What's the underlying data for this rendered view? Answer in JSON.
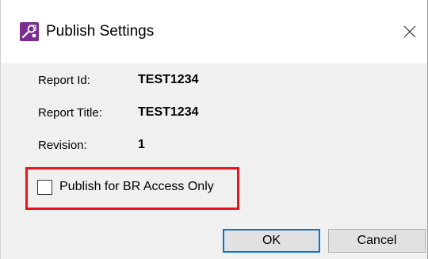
{
  "dialog": {
    "title": "Publish Settings",
    "close_icon": "close-icon",
    "app_icon": "publish-settings-app-icon"
  },
  "fields": [
    {
      "label": "Report Id:",
      "value": "TEST1234"
    },
    {
      "label": "Report Title:",
      "value": "TEST1234"
    },
    {
      "label": "Revision:",
      "value": "1"
    }
  ],
  "br_access": {
    "label": "Publish for BR Access Only",
    "checked": false,
    "highlight_color": "#e8161c"
  },
  "buttons": {
    "ok_label": "OK",
    "cancel_label": "Cancel"
  },
  "colors": {
    "content_background": "#f0f0f0",
    "titlebar_background": "#ffffff",
    "default_button_border": "#0078d7",
    "icon_purple": "#7b2d8e"
  }
}
